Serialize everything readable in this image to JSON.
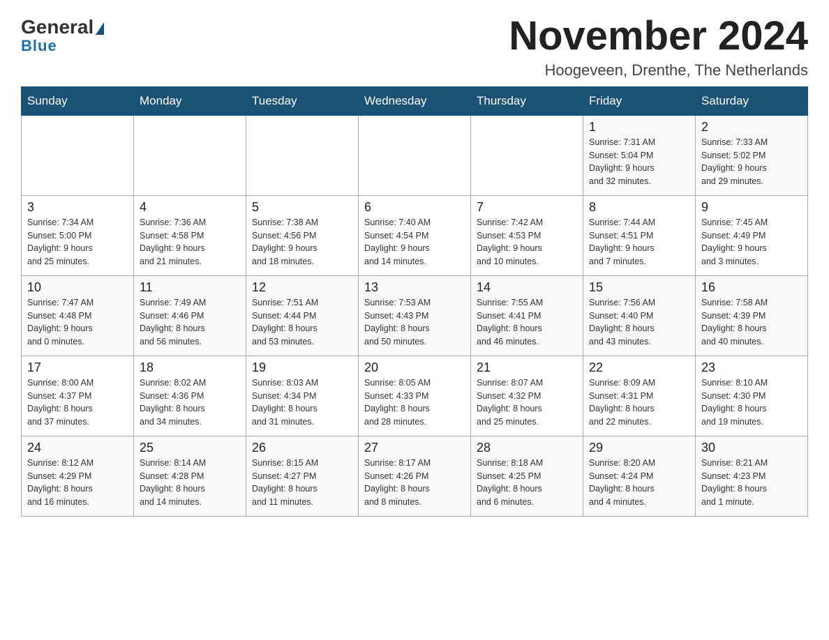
{
  "header": {
    "logo_general": "General",
    "logo_blue": "Blue",
    "month_title": "November 2024",
    "location": "Hoogeveen, Drenthe, The Netherlands"
  },
  "days_of_week": [
    "Sunday",
    "Monday",
    "Tuesday",
    "Wednesday",
    "Thursday",
    "Friday",
    "Saturday"
  ],
  "weeks": [
    [
      {
        "day": "",
        "info": ""
      },
      {
        "day": "",
        "info": ""
      },
      {
        "day": "",
        "info": ""
      },
      {
        "day": "",
        "info": ""
      },
      {
        "day": "",
        "info": ""
      },
      {
        "day": "1",
        "info": "Sunrise: 7:31 AM\nSunset: 5:04 PM\nDaylight: 9 hours\nand 32 minutes."
      },
      {
        "day": "2",
        "info": "Sunrise: 7:33 AM\nSunset: 5:02 PM\nDaylight: 9 hours\nand 29 minutes."
      }
    ],
    [
      {
        "day": "3",
        "info": "Sunrise: 7:34 AM\nSunset: 5:00 PM\nDaylight: 9 hours\nand 25 minutes."
      },
      {
        "day": "4",
        "info": "Sunrise: 7:36 AM\nSunset: 4:58 PM\nDaylight: 9 hours\nand 21 minutes."
      },
      {
        "day": "5",
        "info": "Sunrise: 7:38 AM\nSunset: 4:56 PM\nDaylight: 9 hours\nand 18 minutes."
      },
      {
        "day": "6",
        "info": "Sunrise: 7:40 AM\nSunset: 4:54 PM\nDaylight: 9 hours\nand 14 minutes."
      },
      {
        "day": "7",
        "info": "Sunrise: 7:42 AM\nSunset: 4:53 PM\nDaylight: 9 hours\nand 10 minutes."
      },
      {
        "day": "8",
        "info": "Sunrise: 7:44 AM\nSunset: 4:51 PM\nDaylight: 9 hours\nand 7 minutes."
      },
      {
        "day": "9",
        "info": "Sunrise: 7:45 AM\nSunset: 4:49 PM\nDaylight: 9 hours\nand 3 minutes."
      }
    ],
    [
      {
        "day": "10",
        "info": "Sunrise: 7:47 AM\nSunset: 4:48 PM\nDaylight: 9 hours\nand 0 minutes."
      },
      {
        "day": "11",
        "info": "Sunrise: 7:49 AM\nSunset: 4:46 PM\nDaylight: 8 hours\nand 56 minutes."
      },
      {
        "day": "12",
        "info": "Sunrise: 7:51 AM\nSunset: 4:44 PM\nDaylight: 8 hours\nand 53 minutes."
      },
      {
        "day": "13",
        "info": "Sunrise: 7:53 AM\nSunset: 4:43 PM\nDaylight: 8 hours\nand 50 minutes."
      },
      {
        "day": "14",
        "info": "Sunrise: 7:55 AM\nSunset: 4:41 PM\nDaylight: 8 hours\nand 46 minutes."
      },
      {
        "day": "15",
        "info": "Sunrise: 7:56 AM\nSunset: 4:40 PM\nDaylight: 8 hours\nand 43 minutes."
      },
      {
        "day": "16",
        "info": "Sunrise: 7:58 AM\nSunset: 4:39 PM\nDaylight: 8 hours\nand 40 minutes."
      }
    ],
    [
      {
        "day": "17",
        "info": "Sunrise: 8:00 AM\nSunset: 4:37 PM\nDaylight: 8 hours\nand 37 minutes."
      },
      {
        "day": "18",
        "info": "Sunrise: 8:02 AM\nSunset: 4:36 PM\nDaylight: 8 hours\nand 34 minutes."
      },
      {
        "day": "19",
        "info": "Sunrise: 8:03 AM\nSunset: 4:34 PM\nDaylight: 8 hours\nand 31 minutes."
      },
      {
        "day": "20",
        "info": "Sunrise: 8:05 AM\nSunset: 4:33 PM\nDaylight: 8 hours\nand 28 minutes."
      },
      {
        "day": "21",
        "info": "Sunrise: 8:07 AM\nSunset: 4:32 PM\nDaylight: 8 hours\nand 25 minutes."
      },
      {
        "day": "22",
        "info": "Sunrise: 8:09 AM\nSunset: 4:31 PM\nDaylight: 8 hours\nand 22 minutes."
      },
      {
        "day": "23",
        "info": "Sunrise: 8:10 AM\nSunset: 4:30 PM\nDaylight: 8 hours\nand 19 minutes."
      }
    ],
    [
      {
        "day": "24",
        "info": "Sunrise: 8:12 AM\nSunset: 4:29 PM\nDaylight: 8 hours\nand 16 minutes."
      },
      {
        "day": "25",
        "info": "Sunrise: 8:14 AM\nSunset: 4:28 PM\nDaylight: 8 hours\nand 14 minutes."
      },
      {
        "day": "26",
        "info": "Sunrise: 8:15 AM\nSunset: 4:27 PM\nDaylight: 8 hours\nand 11 minutes."
      },
      {
        "day": "27",
        "info": "Sunrise: 8:17 AM\nSunset: 4:26 PM\nDaylight: 8 hours\nand 8 minutes."
      },
      {
        "day": "28",
        "info": "Sunrise: 8:18 AM\nSunset: 4:25 PM\nDaylight: 8 hours\nand 6 minutes."
      },
      {
        "day": "29",
        "info": "Sunrise: 8:20 AM\nSunset: 4:24 PM\nDaylight: 8 hours\nand 4 minutes."
      },
      {
        "day": "30",
        "info": "Sunrise: 8:21 AM\nSunset: 4:23 PM\nDaylight: 8 hours\nand 1 minute."
      }
    ]
  ]
}
